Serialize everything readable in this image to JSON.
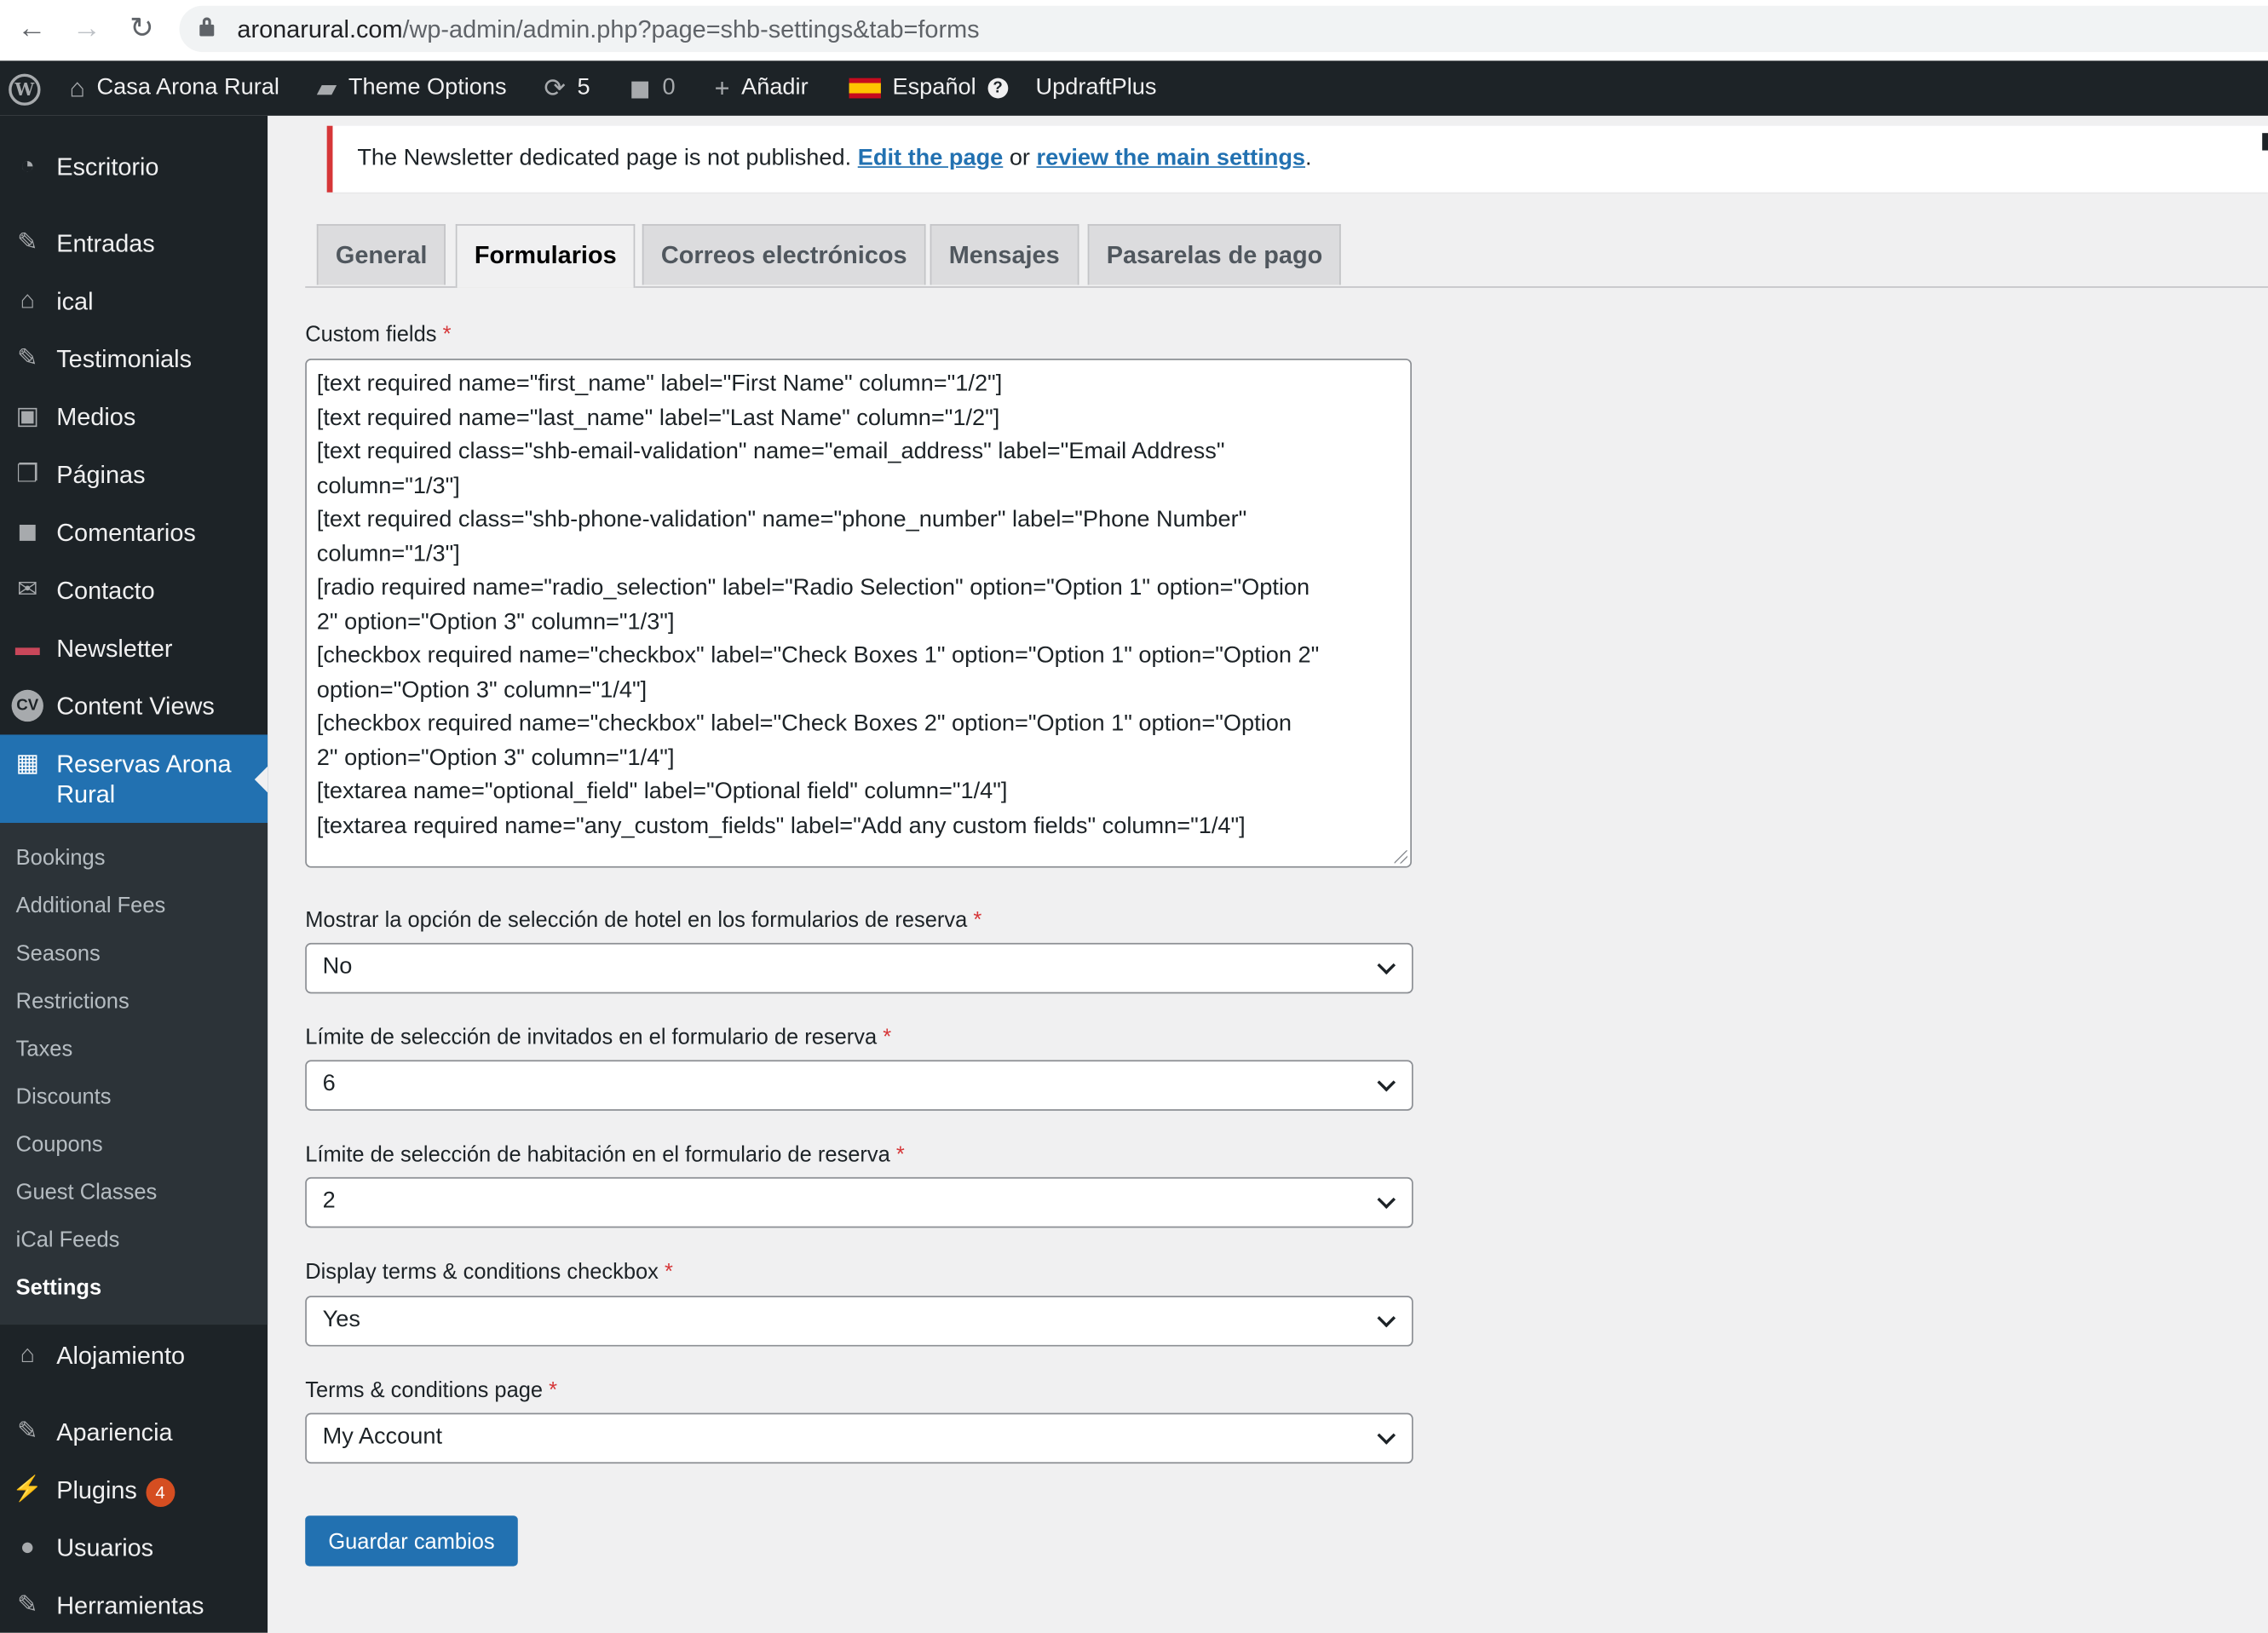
{
  "browser": {
    "url_host": "aronarural.com",
    "url_path": "/wp-admin/admin.php?page=shb-settings&tab=forms",
    "back_icon": "←",
    "forward_icon": "→",
    "reload_icon": "↻"
  },
  "adminbar": {
    "site_name": "Casa Arona Rural",
    "theme_options": "Theme Options",
    "updates_count": "5",
    "comments_count": "0",
    "add_new": "Añadir",
    "language": "Español",
    "updraft": "UpdraftPlus"
  },
  "sidebar": {
    "items": [
      {
        "label": "Escritorio",
        "icon": "◔"
      },
      {
        "label": "Entradas",
        "icon": "✎"
      },
      {
        "label": "ical",
        "icon": "⌂"
      },
      {
        "label": "Testimonials",
        "icon": "✎"
      },
      {
        "label": "Medios",
        "icon": "▣"
      },
      {
        "label": "Páginas",
        "icon": "❐"
      },
      {
        "label": "Comentarios",
        "icon": "◼"
      },
      {
        "label": "Contacto",
        "icon": "✉"
      },
      {
        "label": "Newsletter",
        "icon": "▬"
      },
      {
        "label": "Content Views",
        "icon": "CV"
      },
      {
        "label": "Reservas Arona Rural",
        "icon": "▦"
      }
    ],
    "submenu": [
      "Bookings",
      "Additional Fees",
      "Seasons",
      "Restrictions",
      "Taxes",
      "Discounts",
      "Coupons",
      "Guest Classes",
      "iCal Feeds",
      "Settings"
    ],
    "bottom_items": [
      {
        "label": "Alojamiento",
        "icon": "⌂"
      },
      {
        "label": "Apariencia",
        "icon": "✎"
      },
      {
        "label": "Plugins",
        "icon": "⚡",
        "badge": "4"
      },
      {
        "label": "Usuarios",
        "icon": "●"
      },
      {
        "label": "Herramientas",
        "icon": "✎"
      }
    ]
  },
  "notice": {
    "text": "The Newsletter dedicated page is not published. ",
    "link1": "Edit the page",
    "mid": " or ",
    "link2": "review the main settings",
    "end": "."
  },
  "tabs": [
    "General",
    "Formularios",
    "Correos electrónicos",
    "Mensajes",
    "Pasarelas de pago"
  ],
  "form": {
    "custom_fields_label": "Custom fields",
    "custom_fields_value": "[text required name=\"first_name\" label=\"First Name\" column=\"1/2\"]\n[text required name=\"last_name\" label=\"Last Name\" column=\"1/2\"]\n[text required class=\"shb-email-validation\" name=\"email_address\" label=\"Email Address\"\ncolumn=\"1/3\"]\n[text required class=\"shb-phone-validation\" name=\"phone_number\" label=\"Phone Number\"\ncolumn=\"1/3\"]\n[radio required name=\"radio_selection\" label=\"Radio Selection\" option=\"Option 1\" option=\"Option\n2\" option=\"Option 3\" column=\"1/3\"]\n[checkbox required name=\"checkbox\" label=\"Check Boxes 1\" option=\"Option 1\" option=\"Option 2\"\noption=\"Option 3\" column=\"1/4\"]\n[checkbox required name=\"checkbox\" label=\"Check Boxes 2\" option=\"Option 1\" option=\"Option\n2\" option=\"Option 3\" column=\"1/4\"]\n[textarea name=\"optional_field\" label=\"Optional field\" column=\"1/4\"]\n[textarea required name=\"any_custom_fields\" label=\"Add any custom fields\" column=\"1/4\"]",
    "hotel_select_label": "Mostrar la opción de selección de hotel en los formularios de reserva",
    "hotel_select_value": "No",
    "guest_limit_label": "Límite de selección de invitados en el formulario de reserva",
    "guest_limit_value": "6",
    "room_limit_label": "Límite de selección de habitación en el formulario de reserva",
    "room_limit_value": "2",
    "terms_checkbox_label": "Display terms & conditions checkbox",
    "terms_checkbox_value": "Yes",
    "terms_page_label": "Terms & conditions page",
    "terms_page_value": "My Account",
    "required_mark": "*",
    "save_label": "Guardar cambios"
  }
}
